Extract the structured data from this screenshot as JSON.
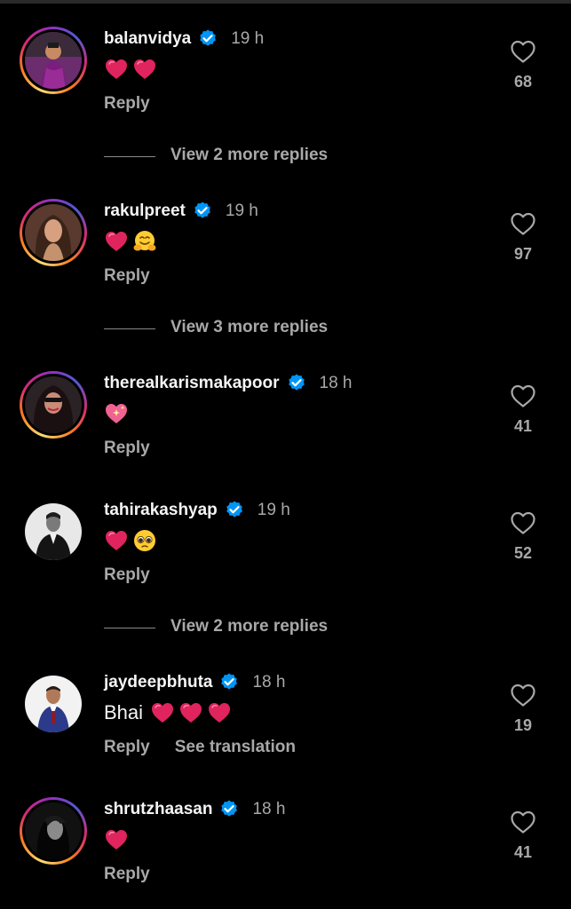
{
  "comments": [
    {
      "username": "balanvidya",
      "time": "19 h",
      "text": "",
      "emojis": [
        "red-heart",
        "red-heart"
      ],
      "likes": "68",
      "reply_label": "Reply",
      "story_ring": true
    },
    {
      "username": "rakulpreet",
      "time": "19 h",
      "text": "",
      "emojis": [
        "red-heart",
        "hugging-face"
      ],
      "likes": "97",
      "reply_label": "Reply",
      "story_ring": true
    },
    {
      "username": "therealkarismakapoor",
      "time": "18 h",
      "text": "",
      "emojis": [
        "sparkling-heart"
      ],
      "likes": "41",
      "reply_label": "Reply",
      "story_ring": true
    },
    {
      "username": "tahirakashyap",
      "time": "19 h",
      "text": "",
      "emojis": [
        "red-heart",
        "pleading-face"
      ],
      "likes": "52",
      "reply_label": "Reply",
      "story_ring": false
    },
    {
      "username": "jaydeepbhuta",
      "time": "18 h",
      "text": "Bhai",
      "emojis": [
        "red-heart",
        "red-heart",
        "red-heart"
      ],
      "likes": "19",
      "reply_label": "Reply",
      "see_translation_label": "See translation",
      "story_ring": false
    },
    {
      "username": "shrutzhaasan",
      "time": "18 h",
      "text": "",
      "emojis": [
        "red-heart"
      ],
      "likes": "41",
      "reply_label": "Reply",
      "story_ring": true
    }
  ],
  "view_more": [
    "View 2 more replies",
    "View 3 more replies",
    "View 2 more replies"
  ],
  "colors": {
    "background": "#000000",
    "primary_text": "#f5f5f5",
    "secondary_text": "#a8a8a8",
    "verified_blue": "#0095f6",
    "heart_red": "#e0245e"
  },
  "icons": {
    "verified": "verified-badge-icon",
    "like": "heart-outline-icon"
  }
}
